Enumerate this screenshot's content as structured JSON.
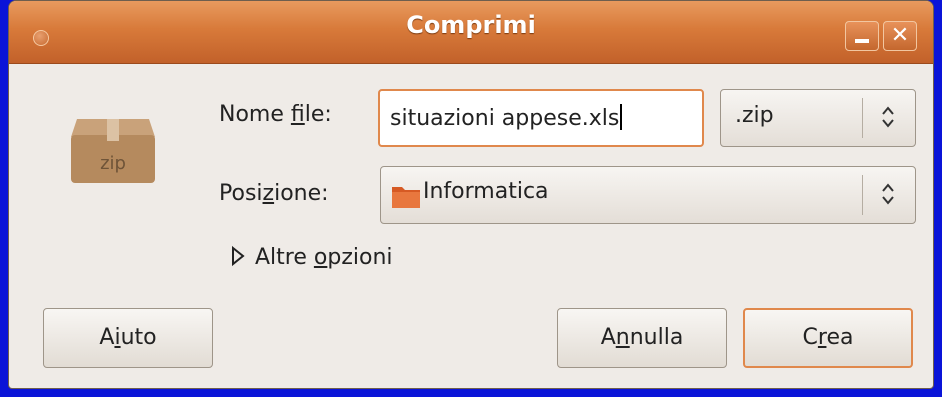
{
  "window": {
    "title": "Comprimi"
  },
  "icon": {
    "label": "zip",
    "name": "zip-archive-icon"
  },
  "form": {
    "filename_label_pre": "Nome ",
    "filename_label_u": "f",
    "filename_label_post": "ile:",
    "filename_value": "situazioni appese.xls",
    "extension_value": ".zip",
    "position_label_pre": "Posi",
    "position_label_u": "z",
    "position_label_post": "ione:",
    "position_value": "Informatica"
  },
  "expander": {
    "label_pre": "Altre ",
    "label_u": "o",
    "label_post": "pzioni"
  },
  "buttons": {
    "help_pre": "A",
    "help_u": "i",
    "help_post": "uto",
    "cancel_pre": "A",
    "cancel_u": "n",
    "cancel_post": "nulla",
    "create_pre": "C",
    "create_u": "r",
    "create_post": "ea"
  },
  "colors": {
    "titlebar": "#d87a3a",
    "focus": "#e0884c",
    "background": "#efebe7",
    "desktop": "#0a14d8"
  }
}
